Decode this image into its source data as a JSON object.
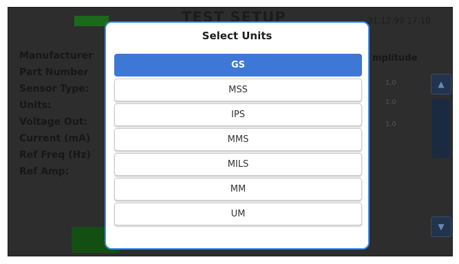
{
  "background": {
    "title": "TEST SETUP",
    "datetime": "31.12.99 17:10",
    "labels": [
      "Manufacturer",
      "Part Number",
      "Sensor Type:",
      "Units:",
      "Voltage Out:",
      "Current (mA)",
      "Ref Freq (Hz)",
      "Ref Amp:"
    ],
    "column_header": "mplitude",
    "values": [
      "1.0",
      "1.0",
      "1.0"
    ],
    "scroll_up_glyph": "▲",
    "scroll_down_glyph": "▼"
  },
  "dialog": {
    "title": "Select Units",
    "selected": "GS",
    "options": [
      "GS",
      "MSS",
      "IPS",
      "MMS",
      "MILS",
      "MM",
      "UM"
    ]
  },
  "colors": {
    "accent": "#3d78d6",
    "dialog_border": "#3a8be8",
    "status_green": "#1b6a1b"
  }
}
